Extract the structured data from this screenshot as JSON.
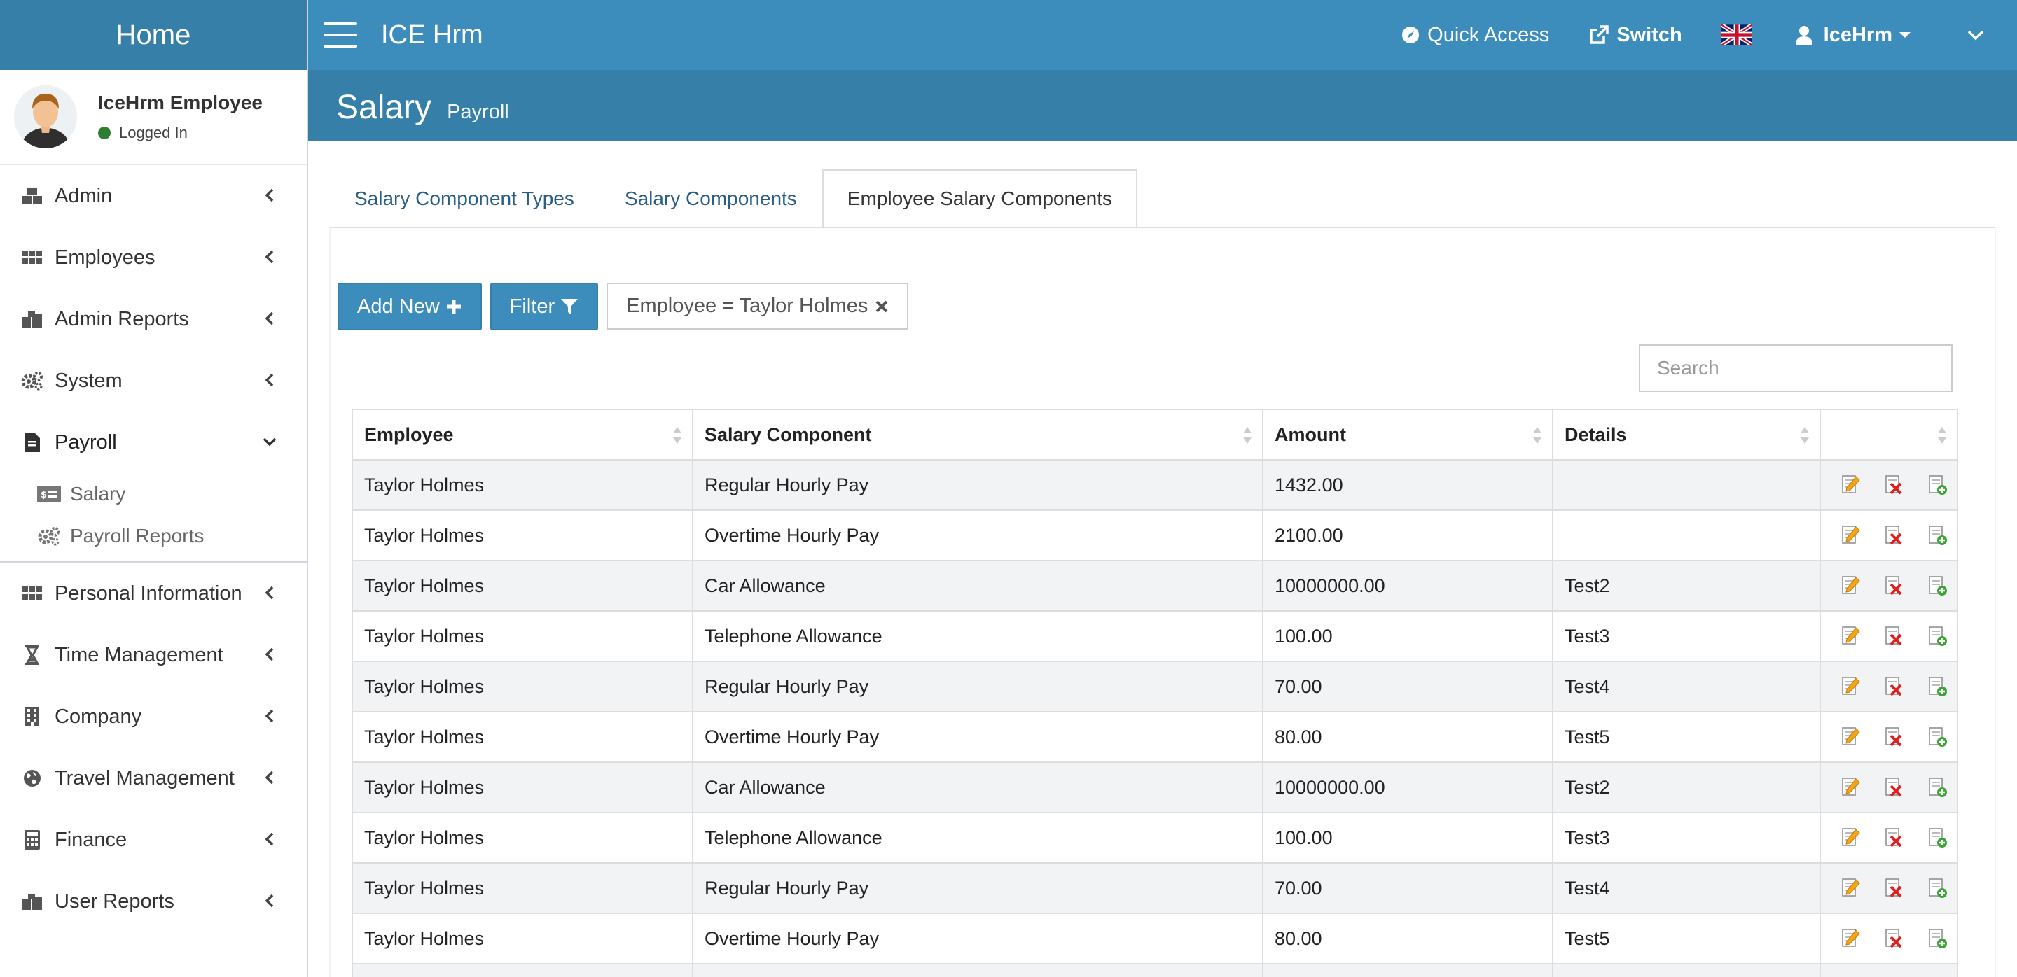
{
  "sidebar": {
    "logo": "Home",
    "user": {
      "name": "IceHrm Employee",
      "status": "Logged In"
    },
    "items": [
      {
        "label": "Admin",
        "icon": "cubes-icon"
      },
      {
        "label": "Employees",
        "icon": "grid-icon"
      },
      {
        "label": "Admin Reports",
        "icon": "reports-icon"
      },
      {
        "label": "System",
        "icon": "gears-icon"
      },
      {
        "label": "Payroll",
        "icon": "file-icon",
        "expanded": true
      },
      {
        "label": "Personal Information",
        "icon": "grid-icon"
      },
      {
        "label": "Time Management",
        "icon": "hourglass-icon"
      },
      {
        "label": "Company",
        "icon": "building-icon"
      },
      {
        "label": "Travel Management",
        "icon": "globe-icon"
      },
      {
        "label": "Finance",
        "icon": "calculator-icon"
      },
      {
        "label": "User Reports",
        "icon": "reports-icon"
      }
    ],
    "payroll_sub": [
      {
        "label": "Salary",
        "icon": "money-icon"
      },
      {
        "label": "Payroll Reports",
        "icon": "gears-icon"
      }
    ]
  },
  "topbar": {
    "app_title": "ICE Hrm",
    "quick_access": "Quick Access",
    "switch": "Switch",
    "user": "IceHrm"
  },
  "page": {
    "title": "Salary",
    "subtitle": "Payroll"
  },
  "tabs": [
    {
      "label": "Salary Component Types",
      "active": false
    },
    {
      "label": "Salary Components",
      "active": false
    },
    {
      "label": "Employee Salary Components",
      "active": true
    }
  ],
  "toolbar": {
    "add_new": "Add New",
    "filter": "Filter",
    "active_filter": "Employee = Taylor Holmes"
  },
  "search": {
    "placeholder": "Search"
  },
  "table": {
    "headers": [
      "Employee",
      "Salary Component",
      "Amount",
      "Details",
      ""
    ],
    "rows": [
      [
        "Taylor Holmes",
        "Regular Hourly Pay",
        "1432.00",
        ""
      ],
      [
        "Taylor Holmes",
        "Overtime Hourly Pay",
        "2100.00",
        ""
      ],
      [
        "Taylor Holmes",
        "Car Allowance",
        "10000000.00",
        "Test2"
      ],
      [
        "Taylor Holmes",
        "Telephone Allowance",
        "100.00",
        "Test3"
      ],
      [
        "Taylor Holmes",
        "Regular Hourly Pay",
        "70.00",
        "Test4"
      ],
      [
        "Taylor Holmes",
        "Overtime Hourly Pay",
        "80.00",
        "Test5"
      ],
      [
        "Taylor Holmes",
        "Car Allowance",
        "10000000.00",
        "Test2"
      ],
      [
        "Taylor Holmes",
        "Telephone Allowance",
        "100.00",
        "Test3"
      ],
      [
        "Taylor Holmes",
        "Regular Hourly Pay",
        "70.00",
        "Test4"
      ],
      [
        "Taylor Holmes",
        "Overtime Hourly Pay",
        "80.00",
        "Test5"
      ],
      [
        "",
        "",
        "",
        ""
      ]
    ],
    "row_actions": [
      "edit-icon",
      "delete-icon",
      "copy-icon"
    ]
  },
  "colors": {
    "brand": "#3c8dbc",
    "brand_dark": "#367fa9",
    "status_online": "#2e7d32"
  }
}
